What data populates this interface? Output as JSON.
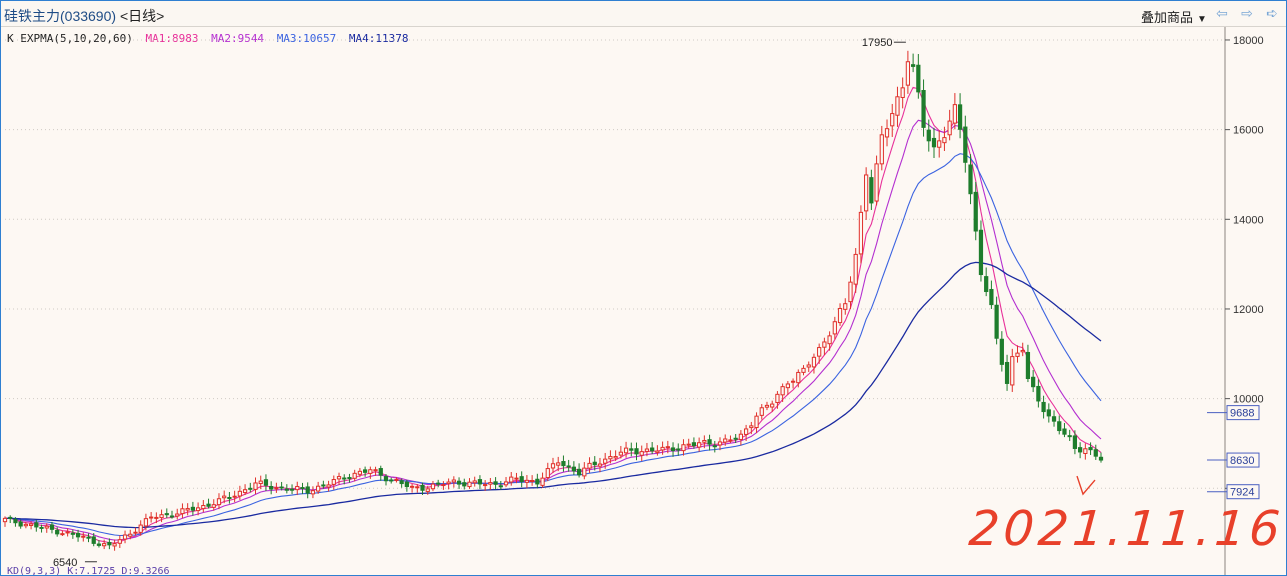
{
  "window": {
    "instrument": "硅铁主力",
    "code": "(033690)",
    "period": "<日线>",
    "overlay_label": "叠加商品",
    "nav_left_icon": "arrow-left-icon",
    "nav_right_icon": "arrow-right-icon"
  },
  "legend": {
    "indicator": "K EXPMA(5,10,20,60)",
    "ma1": "MA1:8983",
    "ma2": "MA2:9544",
    "ma3": "MA3:10657",
    "ma4": "MA4:11378"
  },
  "colors": {
    "up": "#e0302a",
    "down": "#1e7d2c",
    "ma1": "#e8319a",
    "ma2": "#b42fd0",
    "ma3": "#3b63e0",
    "ma4": "#1a2aa0",
    "axis_text": "#333333",
    "grid": "#cfcac4",
    "annotation": "#e8402a"
  },
  "annotation": {
    "handwritten": "2021.11.16"
  },
  "bottom_indicator": "KD(9,3,3)  K:7.1725  D:9.3266",
  "chart_data": {
    "type": "candlestick",
    "y_axis": {
      "ticks": [
        8000,
        10000,
        12000,
        14000,
        16000,
        18000
      ],
      "range": [
        6200,
        18200
      ],
      "position": "right"
    },
    "grid": true,
    "price_markers": [
      {
        "value": 9688,
        "label": "9688"
      },
      {
        "value": 8630,
        "label": "8630"
      },
      {
        "value": 7924,
        "label": "7924"
      }
    ],
    "annotations": [
      {
        "label": "17950",
        "value": 17950,
        "type": "high"
      },
      {
        "label": "6540",
        "value": 6540,
        "type": "low"
      }
    ],
    "anchors": [
      [
        0,
        7300
      ],
      [
        10,
        7050
      ],
      [
        15,
        6900
      ],
      [
        20,
        6700
      ],
      [
        24,
        7000
      ],
      [
        28,
        7350
      ],
      [
        33,
        7450
      ],
      [
        38,
        7600
      ],
      [
        43,
        7800
      ],
      [
        48,
        8100
      ],
      [
        53,
        8000
      ],
      [
        58,
        7950
      ],
      [
        62,
        8100
      ],
      [
        66,
        8300
      ],
      [
        70,
        8400
      ],
      [
        74,
        8200
      ],
      [
        78,
        8000
      ],
      [
        82,
        8050
      ],
      [
        86,
        8150
      ],
      [
        90,
        8100
      ],
      [
        94,
        8100
      ],
      [
        98,
        8200
      ],
      [
        102,
        8150
      ],
      [
        106,
        8600
      ],
      [
        110,
        8350
      ],
      [
        114,
        8600
      ],
      [
        118,
        8800
      ],
      [
        122,
        8850
      ],
      [
        126,
        8850
      ],
      [
        130,
        8950
      ],
      [
        134,
        9000
      ],
      [
        138,
        9050
      ],
      [
        141,
        9150
      ],
      [
        144,
        9650
      ],
      [
        147,
        9900
      ],
      [
        150,
        10400
      ],
      [
        153,
        10600
      ],
      [
        156,
        11100
      ],
      [
        159,
        11700
      ],
      [
        161,
        12100
      ],
      [
        163,
        13200
      ],
      [
        165,
        15100
      ],
      [
        166,
        14400
      ],
      [
        168,
        15800
      ],
      [
        170,
        16400
      ],
      [
        172,
        17000
      ],
      [
        173,
        17600
      ],
      [
        174,
        17300
      ],
      [
        175,
        16700
      ],
      [
        176,
        16100
      ],
      [
        178,
        15600
      ],
      [
        180,
        15900
      ],
      [
        182,
        16400
      ],
      [
        183,
        16000
      ],
      [
        184,
        15400
      ],
      [
        185,
        14600
      ],
      [
        186,
        13700
      ],
      [
        187,
        12800
      ],
      [
        189,
        12000
      ],
      [
        190,
        11300
      ],
      [
        192,
        10400
      ],
      [
        193,
        10900
      ],
      [
        195,
        11100
      ],
      [
        196,
        10400
      ],
      [
        198,
        10000
      ],
      [
        200,
        9600
      ],
      [
        202,
        9300
      ],
      [
        204,
        9100
      ],
      [
        205,
        8900
      ],
      [
        207,
        8900
      ],
      [
        209,
        8700
      ],
      [
        210,
        8630
      ]
    ],
    "series": [
      {
        "name": "MA1:8983",
        "period": 5
      },
      {
        "name": "MA2:9544",
        "period": 10
      },
      {
        "name": "MA3:10657",
        "period": 20
      },
      {
        "name": "MA4:11378",
        "period": 60
      }
    ]
  }
}
